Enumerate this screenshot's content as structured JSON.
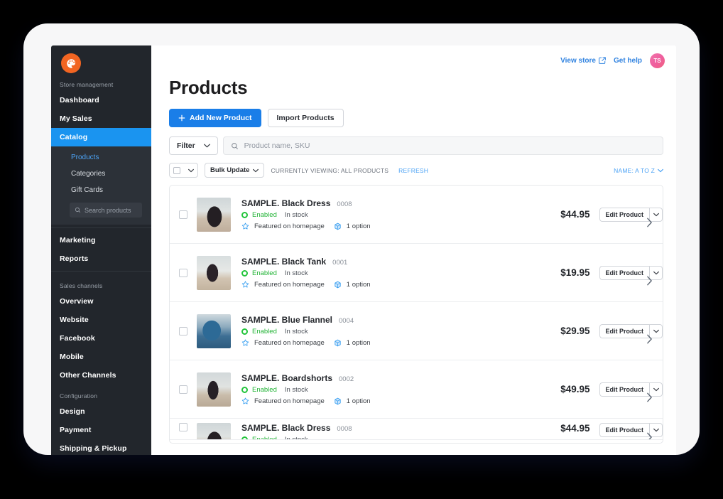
{
  "colors": {
    "brand_orange": "#f26522",
    "accent_blue": "#1a94f0",
    "primary_button": "#1a7ee8",
    "link_blue": "#2f82e0",
    "enabled_green": "#21b335",
    "sidebar_bg": "#22262c",
    "submenu_bg": "#2c3138"
  },
  "sidebar": {
    "logo_name": "ecwid-logo-icon",
    "caption_store": "Store management",
    "items": [
      {
        "label": "Dashboard",
        "active": false
      },
      {
        "label": "My Sales",
        "active": false
      },
      {
        "label": "Catalog",
        "active": true
      }
    ],
    "submenu": [
      {
        "label": "Products",
        "current": true
      },
      {
        "label": "Categories",
        "current": false
      },
      {
        "label": "Gift Cards",
        "current": false
      }
    ],
    "search_placeholder": "Search products",
    "items2": [
      {
        "label": "Marketing"
      },
      {
        "label": "Reports"
      }
    ],
    "caption_sales_channels": "Sales channels",
    "channels": [
      {
        "label": "Overview"
      },
      {
        "label": "Website"
      },
      {
        "label": "Facebook"
      },
      {
        "label": "Mobile"
      },
      {
        "label": "Other Channels"
      }
    ],
    "caption_configuration": "Configuration",
    "configuration": [
      {
        "label": "Design"
      },
      {
        "label": "Payment"
      },
      {
        "label": "Shipping & Pickup"
      }
    ]
  },
  "topbar": {
    "view_store": "View store",
    "view_store_icon": "external-link-icon",
    "get_help": "Get help",
    "avatar_initials": "TS"
  },
  "page": {
    "title": "Products",
    "add_new_product": "Add New Product",
    "import_products": "Import Products"
  },
  "filters": {
    "filter_label": "Filter",
    "search_placeholder": "Product name, SKU",
    "bulk_update": "Bulk Update",
    "currently_viewing": "CURRENTLY VIEWING: ALL PRODUCTS",
    "refresh": "REFRESH",
    "sort_label": "NAME: A TO Z"
  },
  "row_labels": {
    "enabled": "Enabled",
    "in_stock": "In stock",
    "featured": "Featured on homepage",
    "options": "1 option",
    "edit_product": "Edit Product"
  },
  "products": [
    {
      "name": "SAMPLE. Black Dress",
      "sku": "0008",
      "status": "Enabled",
      "stock": "In stock",
      "featured": "Featured on homepage",
      "options": "1 option",
      "price": "$44.95",
      "edit_label": "Edit Product"
    },
    {
      "name": "SAMPLE. Black Tank",
      "sku": "0001",
      "status": "Enabled",
      "stock": "In stock",
      "featured": "Featured on homepage",
      "options": "1 option",
      "price": "$19.95",
      "edit_label": "Edit Product"
    },
    {
      "name": "SAMPLE. Blue Flannel",
      "sku": "0004",
      "status": "Enabled",
      "stock": "In stock",
      "featured": "Featured on homepage",
      "options": "1 option",
      "price": "$29.95",
      "edit_label": "Edit Product"
    },
    {
      "name": "SAMPLE. Boardshorts",
      "sku": "0002",
      "status": "Enabled",
      "stock": "In stock",
      "featured": "Featured on homepage",
      "options": "1 option",
      "price": "$49.95",
      "edit_label": "Edit Product"
    }
  ]
}
